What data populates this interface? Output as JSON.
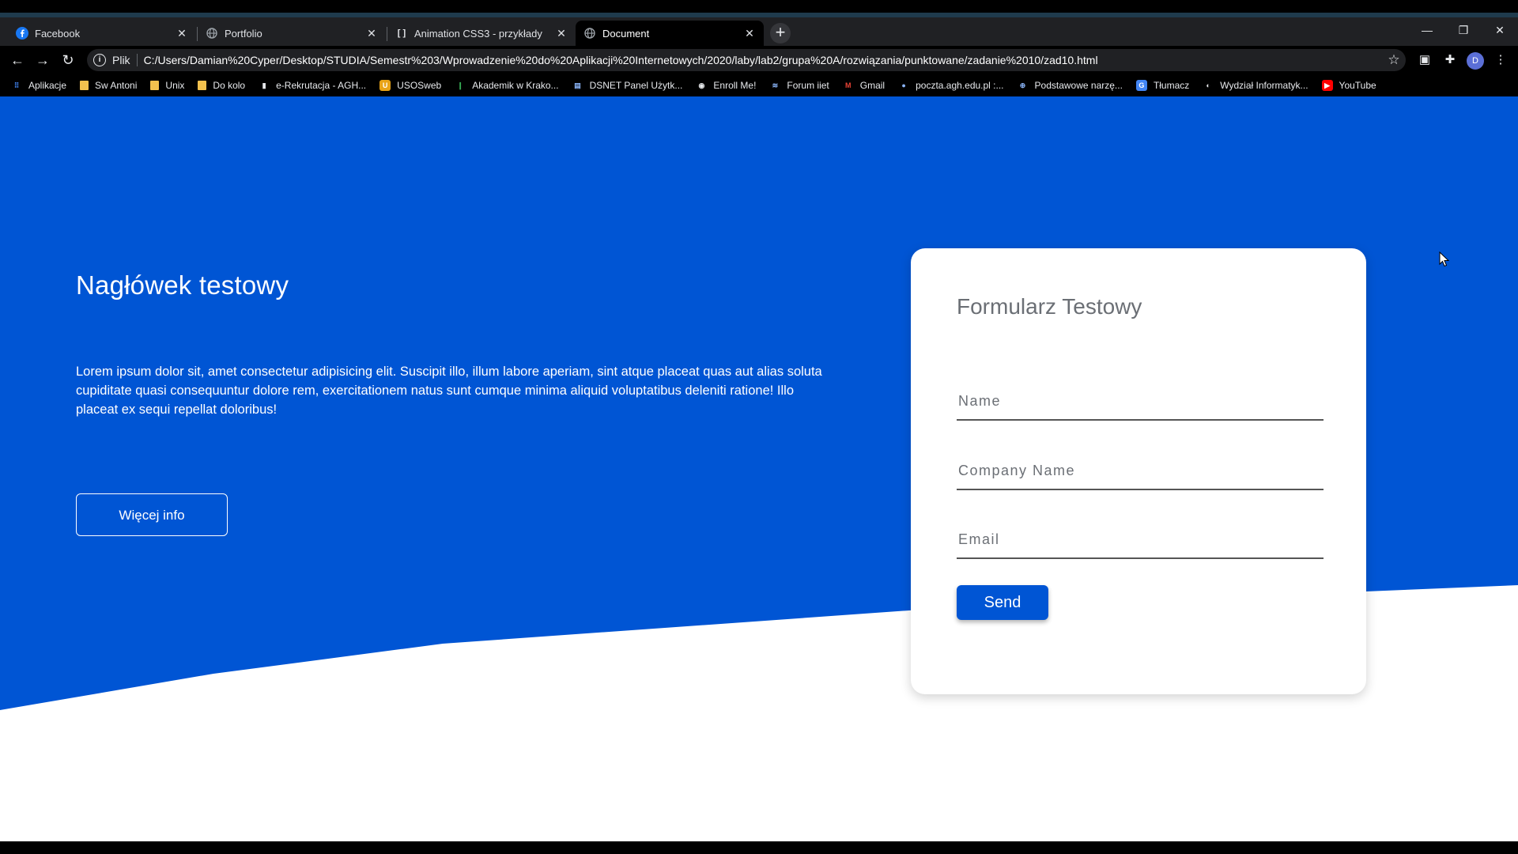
{
  "browser": {
    "tabs": [
      {
        "title": "Facebook",
        "icon": "facebook-icon"
      },
      {
        "title": "Portfolio",
        "icon": "globe-icon"
      },
      {
        "title": "Animation CSS3 - przykłady",
        "icon": "brackets-icon"
      },
      {
        "title": "Document",
        "icon": "globe-icon",
        "active": true
      }
    ],
    "address": {
      "scheme_label": "Plik",
      "url": "C:/Users/Damian%20Cyper/Desktop/STUDIA/Semestr%203/Wprowadzenie%20do%20Aplikacji%20Internetowych/2020/laby/lab2/grupa%20A/rozwiązania/punktowane/zadanie%2010/zad10.html"
    },
    "profile_initial": "D",
    "bookmarks": [
      {
        "label": "Aplikacje",
        "icon": "apps-grid-icon"
      },
      {
        "label": "Sw Antoni",
        "icon": "folder-icon"
      },
      {
        "label": "Unix",
        "icon": "folder-icon"
      },
      {
        "label": "Do kolo",
        "icon": "folder-icon"
      },
      {
        "label": "e-Rekrutacja - AGH...",
        "icon": "agh-icon"
      },
      {
        "label": "USOSweb",
        "icon": "usos-icon"
      },
      {
        "label": "Akademik w Krako...",
        "icon": "akademik-icon"
      },
      {
        "label": "DSNET Panel Użytk...",
        "icon": "dsnet-icon"
      },
      {
        "label": "Enroll Me!",
        "icon": "enroll-icon"
      },
      {
        "label": "Forum iiet",
        "icon": "forum-icon"
      },
      {
        "label": "Gmail",
        "icon": "gmail-icon"
      },
      {
        "label": "poczta.agh.edu.pl :...",
        "icon": "mail-icon"
      },
      {
        "label": "Podstawowe narzę...",
        "icon": "tools-icon"
      },
      {
        "label": "Tłumacz",
        "icon": "translate-icon"
      },
      {
        "label": "Wydział Informatyk...",
        "icon": "faculty-icon"
      },
      {
        "label": "YouTube",
        "icon": "youtube-icon"
      }
    ]
  },
  "hero": {
    "heading": "Nagłówek testowy",
    "text": "Lorem ipsum dolor sit, amet consectetur adipisicing elit. Suscipit illo, illum labore aperiam, sint atque placeat quas aut alias soluta cupiditate quasi consequuntur dolore rem, exercitationem natus sunt cumque minima aliquid voluptatibus deleniti ratione! Illo placeat ex sequi repellat doloribus!",
    "button_label": "Więcej info",
    "background_color": "#0055d4"
  },
  "form": {
    "title": "Formularz Testowy",
    "fields": [
      {
        "placeholder": "Name",
        "value": ""
      },
      {
        "placeholder": "Company Name",
        "value": ""
      },
      {
        "placeholder": "Email",
        "value": ""
      }
    ],
    "submit_label": "Send",
    "accent_color": "#0055d4"
  }
}
